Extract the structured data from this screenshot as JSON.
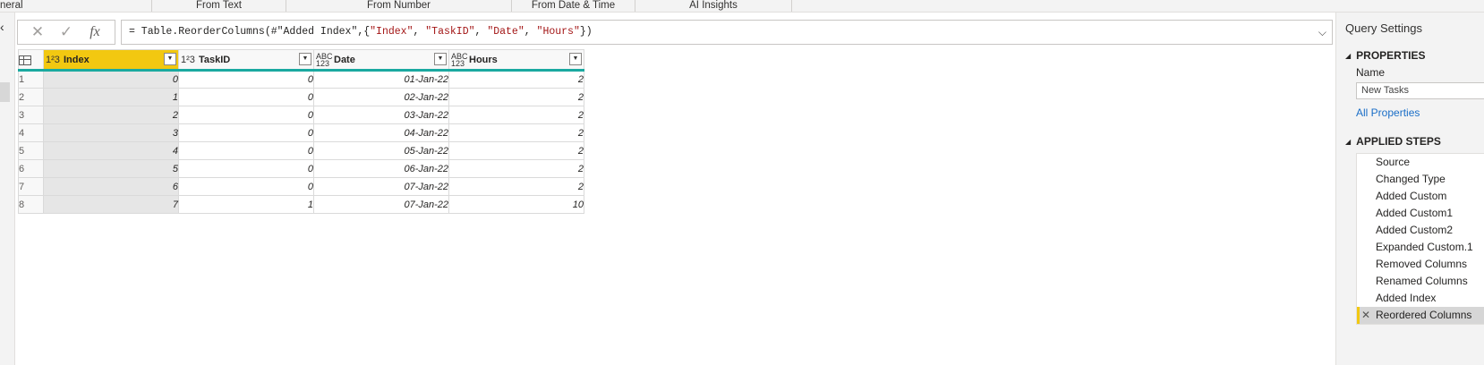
{
  "ribbon": {
    "groups": [
      "neral",
      "From Text",
      "From Number",
      "From Date & Time",
      "AI Insights"
    ]
  },
  "formula_bar": {
    "cancel_icon": "close-icon",
    "commit_icon": "check-icon",
    "fx_label": "fx",
    "expr_prefix": "= Table.ReorderColumns(#\"Added Index\",{",
    "s1": "\"Index\"",
    "sep1": ", ",
    "s2": "\"TaskID\"",
    "sep2": ", ",
    "s3": "\"Date\"",
    "sep3": ", ",
    "s4": "\"Hours\"",
    "expr_suffix": "})",
    "expand_icon": "chevron-down-icon"
  },
  "grid": {
    "columns": [
      {
        "name": "Index",
        "type_icon": "1²3",
        "selected": true
      },
      {
        "name": "TaskID",
        "type_icon": "1²3",
        "selected": false
      },
      {
        "name": "Date",
        "type_icon": "ABC\n123",
        "selected": false
      },
      {
        "name": "Hours",
        "type_icon": "ABC\n123",
        "selected": false
      }
    ],
    "rows": [
      {
        "n": "1",
        "index": "0",
        "taskid": "0",
        "date": "01-Jan-22",
        "hours": "2"
      },
      {
        "n": "2",
        "index": "1",
        "taskid": "0",
        "date": "02-Jan-22",
        "hours": "2"
      },
      {
        "n": "3",
        "index": "2",
        "taskid": "0",
        "date": "03-Jan-22",
        "hours": "2"
      },
      {
        "n": "4",
        "index": "3",
        "taskid": "0",
        "date": "04-Jan-22",
        "hours": "2"
      },
      {
        "n": "5",
        "index": "4",
        "taskid": "0",
        "date": "05-Jan-22",
        "hours": "2"
      },
      {
        "n": "6",
        "index": "5",
        "taskid": "0",
        "date": "06-Jan-22",
        "hours": "2"
      },
      {
        "n": "7",
        "index": "6",
        "taskid": "0",
        "date": "07-Jan-22",
        "hours": "2"
      },
      {
        "n": "8",
        "index": "7",
        "taskid": "1",
        "date": "07-Jan-22",
        "hours": "10"
      }
    ]
  },
  "query_settings": {
    "title": "Query Settings",
    "properties_heading": "PROPERTIES",
    "name_label": "Name",
    "name_value": "New Tasks",
    "all_properties": "All Properties",
    "applied_steps_heading": "APPLIED STEPS",
    "steps": [
      "Source",
      "Changed Type",
      "Added Custom",
      "Added Custom1",
      "Added Custom2",
      "Expanded Custom.1",
      "Removed Columns",
      "Renamed Columns",
      "Added Index",
      "Reordered Columns"
    ],
    "active_step_index": 9
  },
  "colors": {
    "selected_header": "#f2c811",
    "header_underline": "#1aa9a0",
    "link": "#1a6ec7",
    "string_literal": "#a31515"
  }
}
